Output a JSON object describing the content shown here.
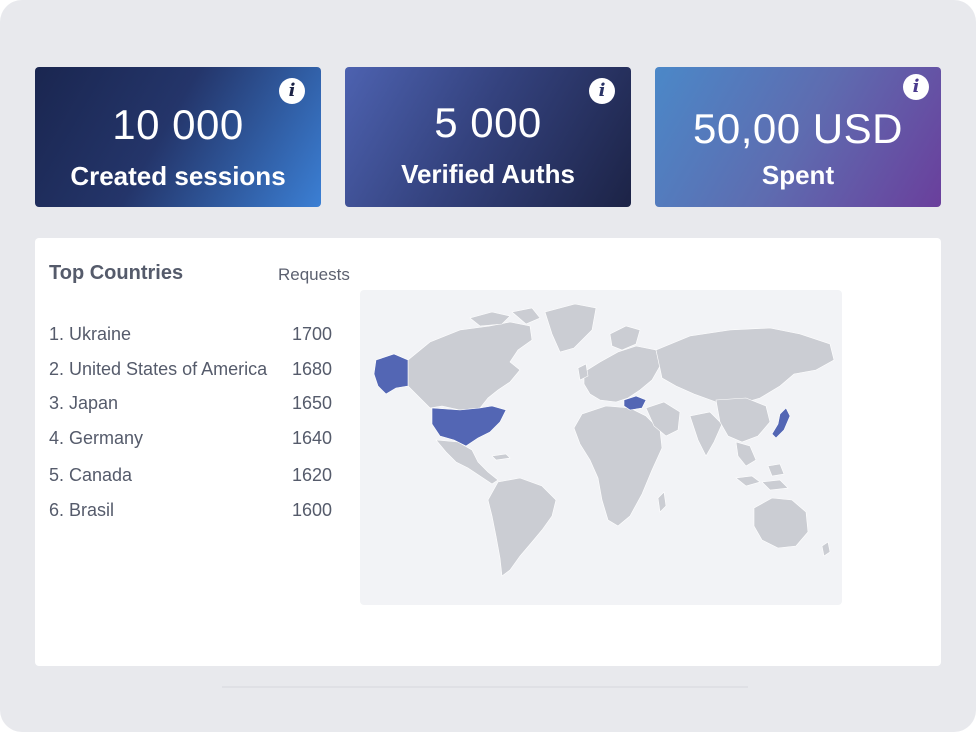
{
  "stats": [
    {
      "value": "10 000",
      "label": "Created sessions",
      "info_icon": "info-icon"
    },
    {
      "value": "5 000",
      "label": "Verified Auths",
      "info_icon": "info-icon"
    },
    {
      "value": "50,00 USD",
      "label": "Spent",
      "info_icon": "info-icon"
    }
  ],
  "info_glyph": "i",
  "top_countries": {
    "title": "Top Countries",
    "column_label": "Requests",
    "rows": [
      {
        "name": "1. Ukraine",
        "requests": "1700"
      },
      {
        "name": "2. United States of America",
        "requests": "1680"
      },
      {
        "name": "3. Japan",
        "requests": "1650"
      },
      {
        "name": "4. Germany",
        "requests": "1640"
      },
      {
        "name": "5. Canada",
        "requests": "1620"
      },
      {
        "name": "6. Brasil",
        "requests": "1600"
      }
    ]
  },
  "colors": {
    "map_land": "#cbcdd3",
    "map_highlight": "#5366b4",
    "map_background": "#f2f3f6"
  }
}
